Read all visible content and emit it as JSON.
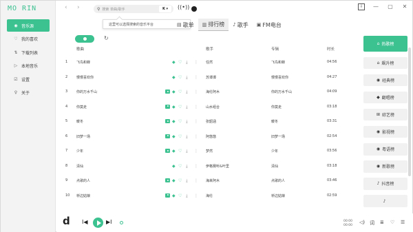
{
  "app": {
    "brand": "MO RIN"
  },
  "sidebar": {
    "items": [
      {
        "label": "音乐源",
        "icon": "record-icon",
        "glyph": "◉",
        "active": true
      },
      {
        "label": "我的喜欢",
        "icon": "heart-icon",
        "glyph": "♡"
      },
      {
        "label": "下载列表",
        "icon": "download-sort-icon",
        "glyph": "⇅"
      },
      {
        "label": "本地音乐",
        "icon": "local-music-icon",
        "glyph": "▷"
      },
      {
        "label": "设置",
        "icon": "settings-icon",
        "glyph": "☑"
      },
      {
        "label": "关于",
        "icon": "bulb-icon",
        "glyph": "♀"
      }
    ]
  },
  "topbar": {
    "back": "‹",
    "forward": "›",
    "search_icon": "⚲",
    "search_placeholder": "搜索 单曲/歌手",
    "platform_selector": "K ▾",
    "wave_icon": "((•))",
    "window": {
      "pin": "⇩",
      "minimize": "—",
      "maximize": "▢",
      "close": "✕"
    }
  },
  "tooltip": "这里可以选择搜索的音乐平台",
  "tabs": [
    {
      "label": "歌单",
      "glyph": "▤",
      "icon": "playlist-icon"
    },
    {
      "label": "排行榜",
      "glyph": "▥",
      "icon": "chart-bars-icon",
      "active": true
    },
    {
      "label": "歌手",
      "glyph": "♪",
      "icon": "singer-icon"
    },
    {
      "label": "FM电台",
      "glyph": "▣",
      "icon": "radio-icon"
    }
  ],
  "controls": {
    "refresh": "↻"
  },
  "table": {
    "headers": {
      "title": "歌曲",
      "artist": "歌手",
      "album": "专辑",
      "duration": "时长"
    },
    "action_glyphs": {
      "play": "◆",
      "heart": "♡",
      "download": "⤓",
      "more": "⋮"
    },
    "rows": [
      {
        "idx": "1",
        "title": "飞鸟和蝉",
        "artist": "任然",
        "album": "飞鸟和蝉",
        "duration": "04:56",
        "mv": false
      },
      {
        "idx": "2",
        "title": "慢慢喜欢你",
        "artist": "苏谭谭",
        "album": "慢慢喜欢你",
        "duration": "04:27",
        "mv": false
      },
      {
        "idx": "3",
        "title": "你的万水千山",
        "artist": "海伦阿木",
        "album": "你的万水千山",
        "duration": "04:09",
        "mv": true
      },
      {
        "idx": "4",
        "title": "你莫走",
        "artist": "山水组合",
        "album": "你莫走",
        "duration": "03:18",
        "mv": true
      },
      {
        "idx": "5",
        "title": "暖冬",
        "artist": "张韶涵",
        "album": "暖冬",
        "duration": "03:31",
        "mv": true
      },
      {
        "idx": "6",
        "title": "旧梦一场",
        "artist": "阿悠悠",
        "album": "旧梦一场",
        "duration": "02:54",
        "mv": true
      },
      {
        "idx": "7",
        "title": "少年",
        "artist": "梦然",
        "album": "少年",
        "duration": "03:56",
        "mv": true
      },
      {
        "idx": "8",
        "title": "清仙",
        "artist": "伊格赛听&叶里",
        "album": "清仙",
        "duration": "03:18",
        "mv": false
      },
      {
        "idx": "9",
        "title": "点歌的人",
        "artist": "海来阿木",
        "album": "点歌的人",
        "duration": "03:46",
        "mv": true
      },
      {
        "idx": "10",
        "title": "桥边姑娘",
        "artist": "海伦",
        "album": "桥边姑娘",
        "duration": "02:59",
        "mv": true
      }
    ]
  },
  "charts": [
    {
      "label": "热歌榜",
      "glyph": "⌂",
      "icon": "hot-icon",
      "active": true
    },
    {
      "label": "飙升榜",
      "glyph": "⌂",
      "icon": "rising-icon"
    },
    {
      "label": "经典榜",
      "glyph": "◉",
      "icon": "classic-icon"
    },
    {
      "label": "翻唱榜",
      "glyph": "◆",
      "icon": "cover-icon"
    },
    {
      "label": "綜艺榜",
      "glyph": "⊞",
      "icon": "variety-icon"
    },
    {
      "label": "影视榜",
      "glyph": "◉",
      "icon": "film-icon"
    },
    {
      "label": "粤语榜",
      "glyph": "◉",
      "icon": "cantonese-icon"
    },
    {
      "label": "新歌榜",
      "glyph": "◉",
      "icon": "new-song-icon"
    },
    {
      "label": "抖音榜",
      "glyph": "♪",
      "icon": "douyin-icon"
    },
    {
      "label": "",
      "glyph": "♪",
      "icon": "tiktok-icon"
    }
  ],
  "player": {
    "logo": "d",
    "prev": "I◀",
    "next": "▶I",
    "time_current": "00:00",
    "time_total": "00:00",
    "ctrl_glyphs": {
      "volume": "◁)",
      "lyrics": "词",
      "playlist": "≣",
      "like": "♡",
      "list": "☰"
    }
  }
}
